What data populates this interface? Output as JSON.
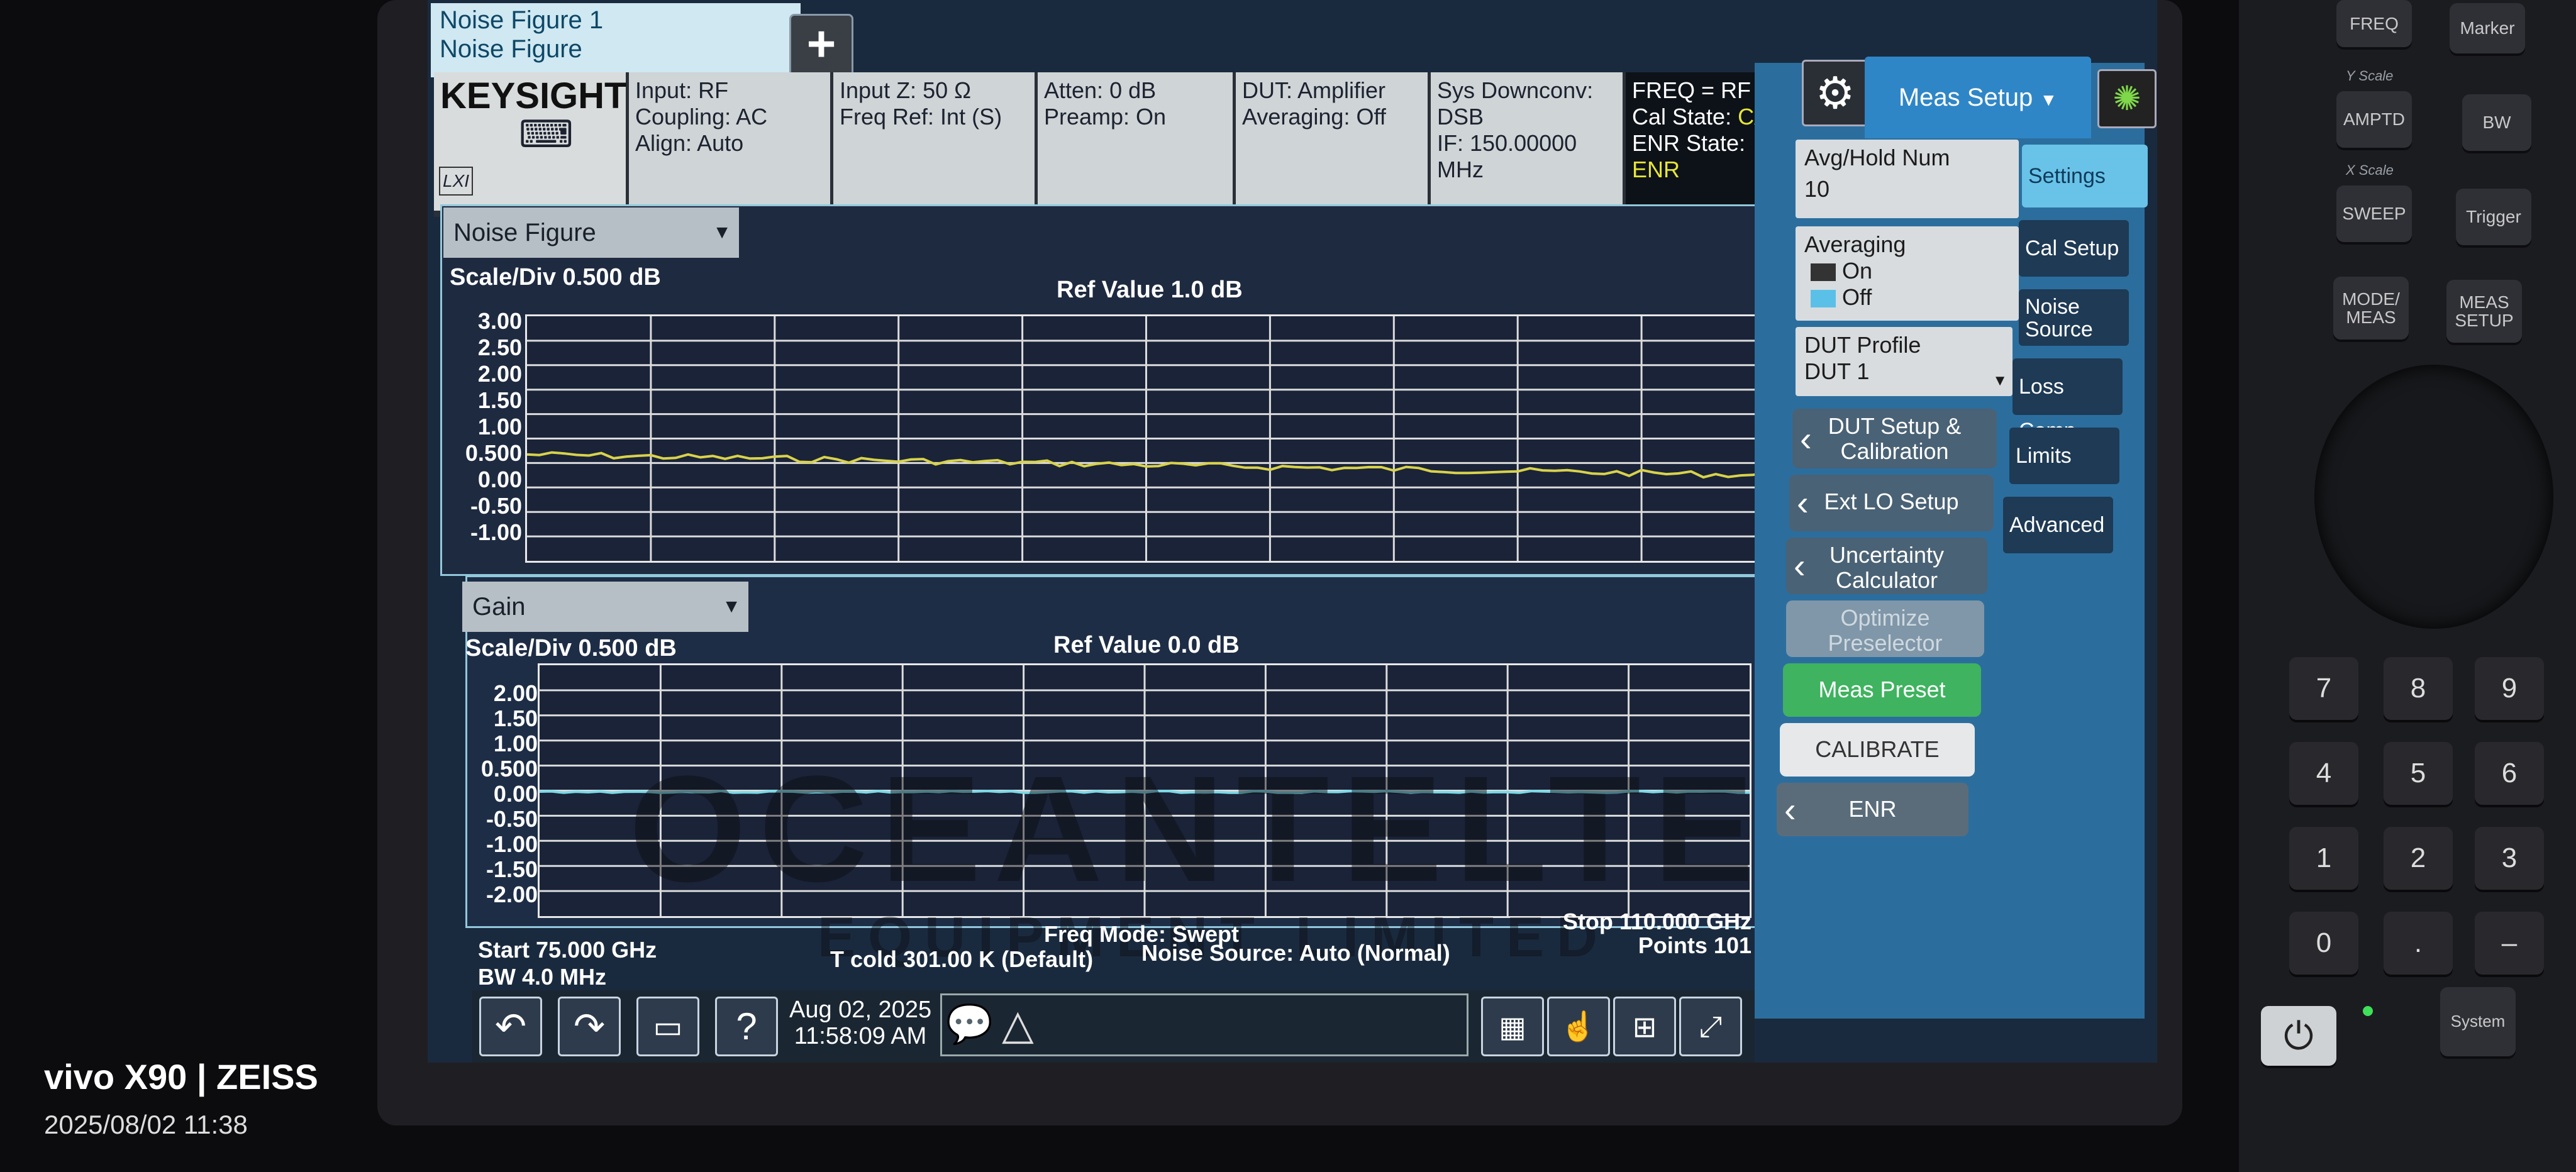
{
  "camera": {
    "brand": "vivo X90 | ZEISS",
    "timestamp": "2025/08/02 11:38"
  },
  "tabs": {
    "line1": "Noise Figure 1",
    "line2": "Noise Figure"
  },
  "brand": {
    "logo": "KEYSIGHT",
    "lxi": "LXI"
  },
  "info": {
    "input": "Input: RF",
    "coupling": "Coupling: AC",
    "align": "Align: Auto",
    "inputz": "Input Z: 50 Ω",
    "freqref": "Freq Ref: Int (S)",
    "atten": "Atten: 0 dB",
    "preamp": "Preamp: On",
    "dut": "DUT: Amplifier",
    "averaging": "Averaging: Off",
    "sysdown": "Sys Downconv: DSB",
    "if": "IF: 150.00000 MHz",
    "freq": "FREQ = RF",
    "calstate_label": "Cal State:",
    "calstate_value": "CAL",
    "enrstate_label": "ENR State:",
    "enrstate_value": "ENR"
  },
  "trace1": {
    "name": "Noise Figure",
    "scale": "Scale/Div 0.500 dB",
    "ref": "Ref Value 1.0 dB",
    "ticks": [
      "3.00",
      "2.50",
      "2.00",
      "1.50",
      "1.00",
      "0.500",
      "0.00",
      "-0.50",
      "-1.00"
    ],
    "color": "#d8d24a"
  },
  "trace2": {
    "name": "Gain",
    "scale": "Scale/Div 0.500 dB",
    "ref": "Ref Value 0.0 dB",
    "ticks": [
      "2.00",
      "1.50",
      "1.00",
      "0.500",
      "0.00",
      "-0.50",
      "-1.00",
      "-1.50",
      "-2.00"
    ],
    "color": "#7ad9e6"
  },
  "status": {
    "start": "Start 75.000 GHz",
    "bw": "BW 4.0 MHz",
    "freqmode": "Freq Mode: Swept",
    "tcold": "T cold 301.00 K (Default)",
    "noisesource": "Noise Source: Auto (Normal)",
    "stop": "Stop 110.000 GHz",
    "points": "Points 101"
  },
  "taskbar": {
    "date": "Aug 02, 2025",
    "time": "11:58:09 AM"
  },
  "softkeys": {
    "menu_title": "Meas Setup",
    "avg_hold_label": "Avg/Hold Num",
    "avg_hold_value": "10",
    "averaging_label": "Averaging",
    "on": "On",
    "off": "Off",
    "dut_profile_label": "DUT Profile",
    "dut_profile_value": "DUT 1",
    "dut_setup_line1": "DUT Setup &",
    "dut_setup_line2": "Calibration",
    "ext_lo": "Ext LO Setup",
    "uncert_line1": "Uncertainty",
    "uncert_line2": "Calculator",
    "optimize_line1": "Optimize",
    "optimize_line2": "Preselector",
    "meas_preset": "Meas Preset",
    "calibrate": "CALIBRATE",
    "enr": "ENR"
  },
  "righttabs": [
    "Settings",
    "Cal Setup",
    "Noise Source",
    "Loss Comp",
    "Limits",
    "Advanced"
  ],
  "hwkeys": {
    "freq": "FREQ",
    "marker": "Marker",
    "yscale": "Y Scale",
    "amptd": "AMPTD",
    "bw": "BW",
    "xscale": "X Scale",
    "sweep": "SWEEP",
    "trigger": "Trigger",
    "mode": "MODE/ MEAS",
    "meas": "MEAS SETUP",
    "system": "System",
    "nums": [
      "7",
      "8",
      "9",
      "4",
      "5",
      "6",
      "1",
      "2",
      "3",
      "0",
      ".",
      "–"
    ]
  },
  "watermark": {
    "main": "OCEANTELTEST",
    "sub": "EQUIPMENT LIMITED"
  }
}
